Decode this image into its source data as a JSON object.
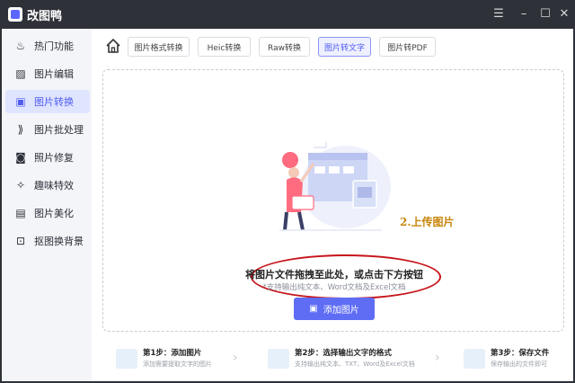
{
  "window": {
    "title": "改图鸭",
    "controls": [
      "menu",
      "minimize",
      "maximize",
      "close"
    ]
  },
  "sidebar": {
    "items": [
      {
        "label": "热门功能",
        "icon": "flame-icon",
        "active": false
      },
      {
        "label": "图片编辑",
        "icon": "image-edit-icon",
        "active": false
      },
      {
        "label": "图片转换",
        "icon": "image-convert-icon",
        "active": true
      },
      {
        "label": "图片批处理",
        "icon": "batch-icon",
        "active": false
      },
      {
        "label": "照片修复",
        "icon": "photo-repair-icon",
        "active": false
      },
      {
        "label": "趣味特效",
        "icon": "sparkle-icon",
        "active": false
      },
      {
        "label": "图片美化",
        "icon": "beautify-icon",
        "active": false
      },
      {
        "label": "抠图换背景",
        "icon": "cutout-icon",
        "active": false
      }
    ]
  },
  "tabs": [
    {
      "label": "图片格式转换",
      "active": false
    },
    {
      "label": "Heic转换",
      "active": false
    },
    {
      "label": "Raw转换",
      "active": false
    },
    {
      "label": "图片转文字",
      "active": true
    },
    {
      "label": "图片转PDF",
      "active": false
    }
  ],
  "dropzone": {
    "main_text": "将图片文件拖拽至此处，或点击下方按钮",
    "sub_text": "*支持输出纯文本、Word文档及Excel文档",
    "button_label": "添加图片",
    "annotation": "2.上传图片"
  },
  "steps": [
    {
      "title": "第1步：添加图片",
      "desc": "添加需要提取文字的图片"
    },
    {
      "title": "第2步：选择输出文字的格式",
      "desc": "支持输出纯文本、TXT、Word及Excel文档"
    },
    {
      "title": "第3步：保存文件",
      "desc": "保存输出的文件即可"
    }
  ],
  "colors": {
    "accent": "#5f6df5",
    "annotation_oval": "#c7151b",
    "annotation_text": "#c8860b"
  }
}
